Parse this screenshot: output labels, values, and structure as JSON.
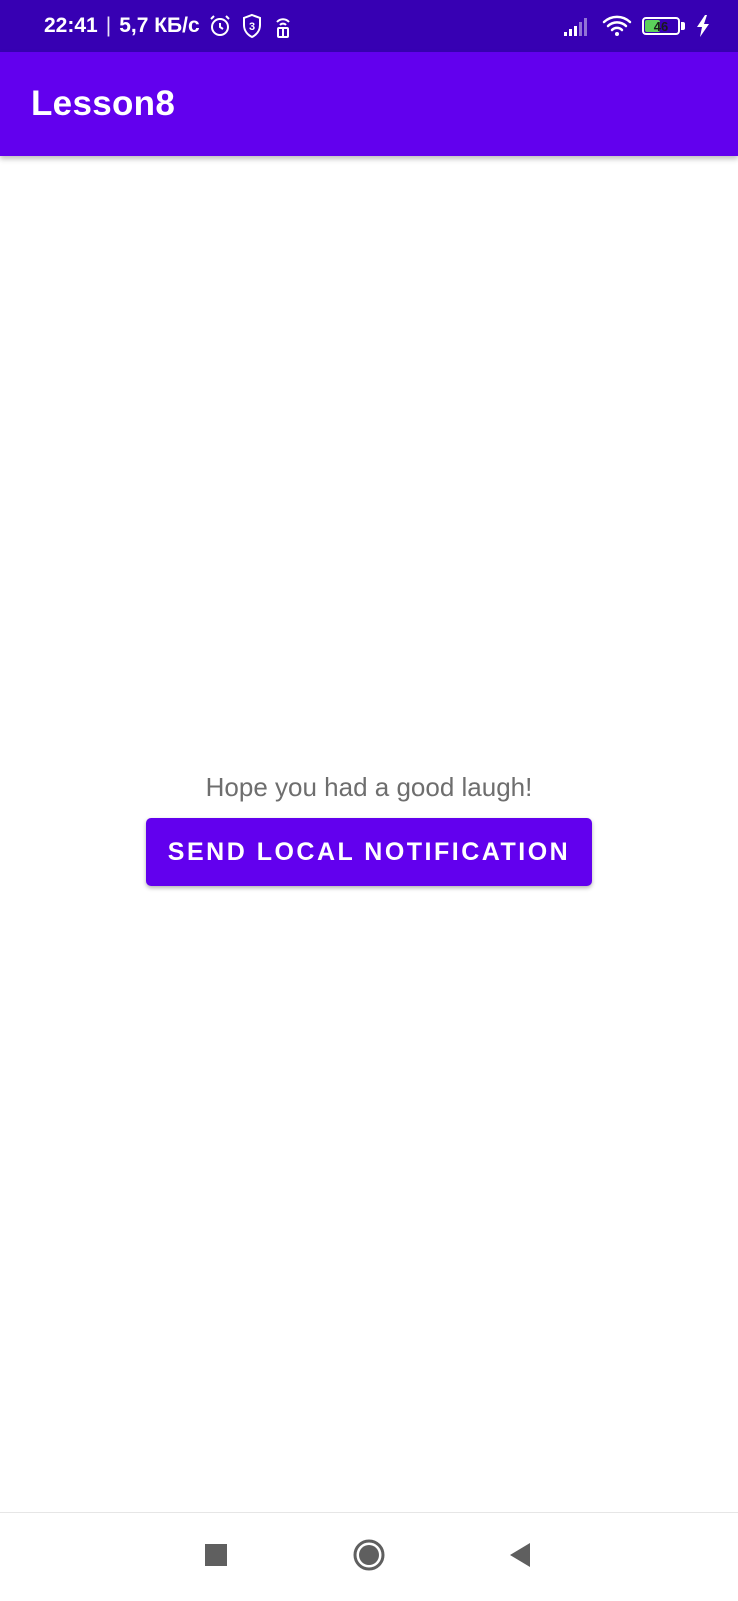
{
  "status_bar": {
    "time": "22:41",
    "separator": "|",
    "network_speed": "5,7 КБ/с",
    "battery_level": "46",
    "battery_fraction": 0.46,
    "icons": [
      "alarm-icon",
      "shield-3-icon",
      "hotspot-icon",
      "signal-icon",
      "wifi-icon",
      "battery-icon",
      "charging-icon"
    ]
  },
  "app_bar": {
    "title": "Lesson8",
    "color": "#6200ee"
  },
  "main": {
    "message": "Hope you had a good laugh!",
    "button_label": "SEND LOCAL NOTIFICATION"
  },
  "nav_bar": {
    "buttons": [
      "recents-icon",
      "home-icon",
      "back-icon"
    ]
  },
  "colors": {
    "status_bar": "#3700b3",
    "primary": "#6200ee",
    "text_secondary": "#6e6e6e",
    "battery_fill": "#5bd15b"
  }
}
